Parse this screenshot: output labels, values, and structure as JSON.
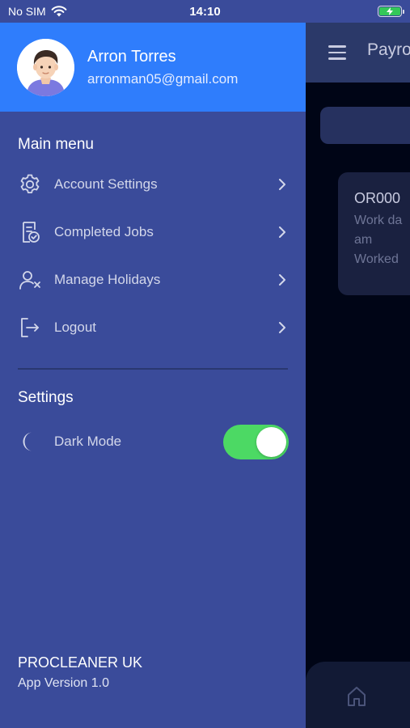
{
  "status_bar": {
    "carrier": "No SIM",
    "time": "14:10",
    "wifi_icon": "wifi-icon",
    "battery_icon": "battery-charging-icon"
  },
  "background_app": {
    "title": "Payro",
    "menu_icon": "hamburger-menu-icon",
    "card": {
      "id": "OR000",
      "line1": "Work da",
      "line2": "am",
      "line3": "Worked"
    },
    "home_icon": "home-icon"
  },
  "profile": {
    "name": "Arron Torres",
    "email": "arronman05@gmail.com",
    "avatar_icon": "avatar-icon"
  },
  "main_menu": {
    "title": "Main menu",
    "items": [
      {
        "label": "Account Settings",
        "icon": "settings-gear-icon"
      },
      {
        "label": "Completed Jobs",
        "icon": "document-check-icon"
      },
      {
        "label": "Manage Holidays",
        "icon": "user-remove-icon"
      },
      {
        "label": "Logout",
        "icon": "logout-icon"
      }
    ]
  },
  "settings": {
    "title": "Settings",
    "dark_mode": {
      "label": "Dark Mode",
      "icon": "moon-icon",
      "enabled": true
    }
  },
  "footer": {
    "company": "PROCLEANER UK",
    "version": "App Version 1.0"
  },
  "colors": {
    "drawer_bg": "#3a4b9a",
    "profile_bg": "#2f7dfc",
    "toggle_on": "#4cd964",
    "background_app": "#000516"
  }
}
